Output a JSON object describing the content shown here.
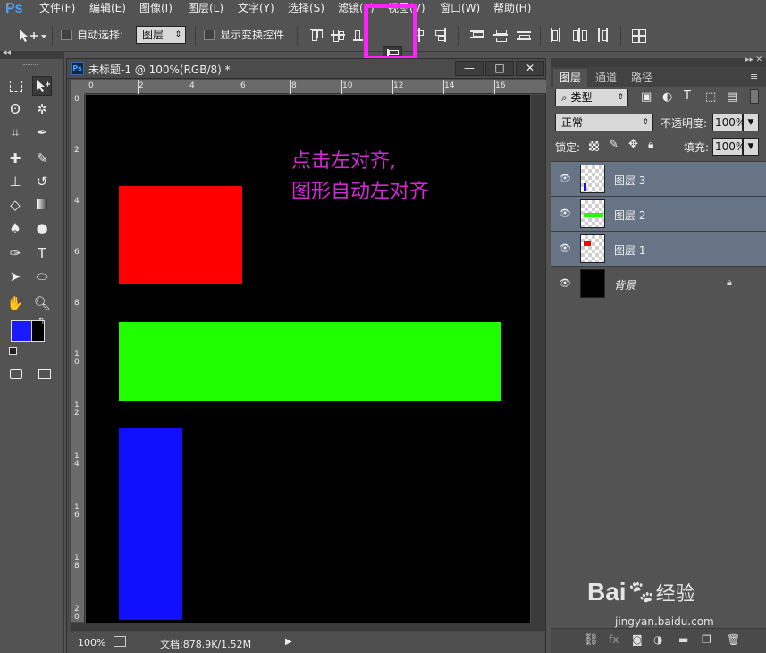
{
  "app": {
    "logo": "Ps",
    "menu": [
      "文件(F)",
      "编辑(E)",
      "图像(I)",
      "图层(L)",
      "文字(Y)",
      "选择(S)",
      "滤镜(T)",
      "视图(V)",
      "窗口(W)",
      "帮助(H)"
    ]
  },
  "options": {
    "auto_select_label": "自动选择:",
    "auto_select_value": "图层",
    "show_transform_label": "显示变换控件"
  },
  "document": {
    "title": "未标题-1 @ 100%(RGB/8) *",
    "ps_badge": "Ps",
    "ruler_h": [
      "0",
      "2",
      "4",
      "6",
      "8",
      "10",
      "12",
      "14",
      "16"
    ],
    "ruler_v": [
      "0",
      "2",
      "4",
      "6",
      "8",
      "10",
      "12",
      "14",
      "16",
      "18",
      "20"
    ],
    "annotation_line1": "点击左对齐,",
    "annotation_line2": "图形自动左对齐",
    "shapes": [
      {
        "name": "red-rect",
        "color": "#ff0000"
      },
      {
        "name": "green-rect",
        "color": "#1fff00"
      },
      {
        "name": "blue-rect",
        "color": "#1010ff"
      }
    ],
    "zoom": "100%",
    "doc_info": "文档:878.9K/1.52M"
  },
  "tools": {
    "foreground_color": "#1a1aff",
    "background_color": "#000000"
  },
  "panel": {
    "tabs": [
      "图层",
      "通道",
      "路径"
    ],
    "filter_kind": "类型",
    "blend_mode": "正常",
    "opacity_label": "不透明度:",
    "opacity_value": "100%",
    "lock_label": "锁定:",
    "fill_label": "填充:",
    "fill_value": "100%",
    "layers": [
      {
        "name": "图层 3",
        "selected": true
      },
      {
        "name": "图层 2",
        "selected": true
      },
      {
        "name": "图层 1",
        "selected": true
      },
      {
        "name": "背景",
        "selected": false
      }
    ]
  },
  "watermark": {
    "brand": "Bai",
    "brand2": "经验",
    "url": "jingyan.baidu.com"
  },
  "highlight_color": "#ff22ff",
  "annotation_color": "#d22ad2"
}
